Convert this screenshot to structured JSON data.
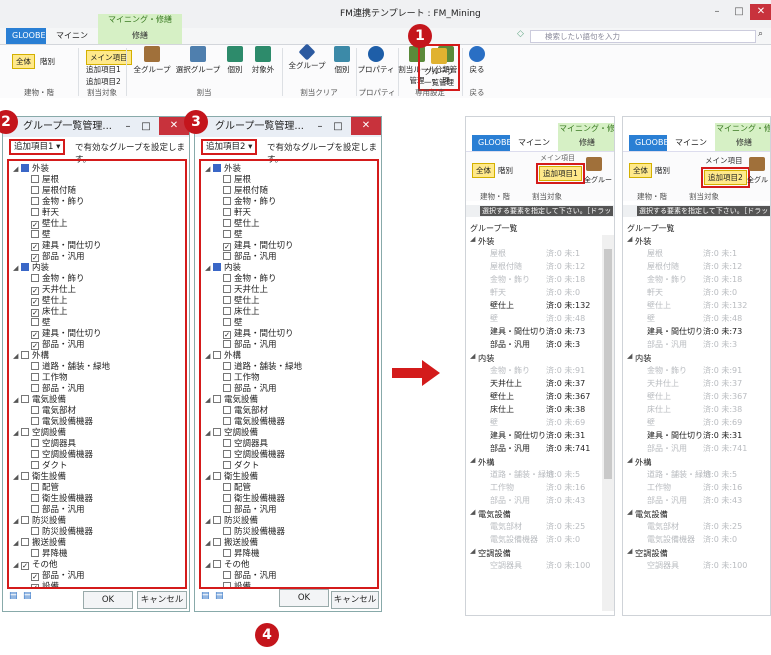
{
  "ribbon": {
    "context_group": "マイニング・修繕",
    "tabs": [
      "GLOOBE",
      "マイニング",
      "修繕"
    ],
    "title": "FM連携テンプレート : FM_Mining",
    "search_placeholder": "検索したい語句を入力",
    "buttons": {
      "all": "全体",
      "partial": "階別",
      "main_item": "メイン項目",
      "extra1": "追加項目1",
      "extra2": "追加項目2",
      "all_groups": "全グループ",
      "select_groups": "選択グループ",
      "individual": "個別",
      "excluded": "対象外",
      "clear_all_groups": "全グループ",
      "clear_individual": "個別",
      "property": "プロパティ",
      "assign_rule": "割当ルール\n管理",
      "category_mgmt": "分類管理",
      "group_list_mgmt": "グループ\n一覧管理",
      "back": "戻る"
    },
    "groups": [
      "建物・階",
      "割当対象",
      "割当",
      "割当クリア",
      "プロパティ",
      "専用設定",
      "戻る"
    ]
  },
  "markers": [
    "1",
    "2",
    "3",
    "4"
  ],
  "dialog1": {
    "title": "グループ一覧管理...",
    "selector": "追加項目1",
    "hint": "で有効なグループを設定します。",
    "tree": [
      {
        "label": "外装",
        "level": 0,
        "state": "part"
      },
      {
        "label": "屋根",
        "level": 1,
        "state": "off"
      },
      {
        "label": "屋根付随",
        "level": 1,
        "state": "off"
      },
      {
        "label": "金物・飾り",
        "level": 1,
        "state": "off"
      },
      {
        "label": "軒天",
        "level": 1,
        "state": "off"
      },
      {
        "label": "壁仕上",
        "level": 1,
        "state": "on"
      },
      {
        "label": "壁",
        "level": 1,
        "state": "off"
      },
      {
        "label": "建具・間仕切り",
        "level": 1,
        "state": "on"
      },
      {
        "label": "部品・汎用",
        "level": 1,
        "state": "on"
      },
      {
        "label": "内装",
        "level": 0,
        "state": "part"
      },
      {
        "label": "金物・飾り",
        "level": 1,
        "state": "off"
      },
      {
        "label": "天井仕上",
        "level": 1,
        "state": "on"
      },
      {
        "label": "壁仕上",
        "level": 1,
        "state": "on"
      },
      {
        "label": "床仕上",
        "level": 1,
        "state": "on"
      },
      {
        "label": "壁",
        "level": 1,
        "state": "off"
      },
      {
        "label": "建具・間仕切り",
        "level": 1,
        "state": "on"
      },
      {
        "label": "部品・汎用",
        "level": 1,
        "state": "on"
      },
      {
        "label": "外構",
        "level": 0,
        "state": "off"
      },
      {
        "label": "道路・舗装・緑地",
        "level": 1,
        "state": "off"
      },
      {
        "label": "工作物",
        "level": 1,
        "state": "off"
      },
      {
        "label": "部品・汎用",
        "level": 1,
        "state": "off"
      },
      {
        "label": "電気設備",
        "level": 0,
        "state": "off"
      },
      {
        "label": "電気部材",
        "level": 1,
        "state": "off"
      },
      {
        "label": "電気設備機器",
        "level": 1,
        "state": "off"
      },
      {
        "label": "空調設備",
        "level": 0,
        "state": "off"
      },
      {
        "label": "空調器具",
        "level": 1,
        "state": "off"
      },
      {
        "label": "空調設備機器",
        "level": 1,
        "state": "off"
      },
      {
        "label": "ダクト",
        "level": 1,
        "state": "off"
      },
      {
        "label": "衛生設備",
        "level": 0,
        "state": "off"
      },
      {
        "label": "配管",
        "level": 1,
        "state": "off"
      },
      {
        "label": "衛生設備機器",
        "level": 1,
        "state": "off"
      },
      {
        "label": "部品・汎用",
        "level": 1,
        "state": "off"
      },
      {
        "label": "防災設備",
        "level": 0,
        "state": "off"
      },
      {
        "label": "防災設備機器",
        "level": 1,
        "state": "off"
      },
      {
        "label": "搬送設備",
        "level": 0,
        "state": "off"
      },
      {
        "label": "昇降機",
        "level": 1,
        "state": "off"
      },
      {
        "label": "その他",
        "level": 0,
        "state": "on"
      },
      {
        "label": "部品・汎用",
        "level": 1,
        "state": "on"
      },
      {
        "label": "設備",
        "level": 1,
        "state": "on"
      }
    ],
    "ok": "OK",
    "cancel": "キャンセル"
  },
  "dialog2": {
    "title": "グループ一覧管理...",
    "selector": "追加項目2",
    "hint": "で有効なグループを設定します。",
    "tree": [
      {
        "label": "外装",
        "level": 0,
        "state": "part"
      },
      {
        "label": "屋根",
        "level": 1,
        "state": "off"
      },
      {
        "label": "屋根付随",
        "level": 1,
        "state": "off"
      },
      {
        "label": "金物・飾り",
        "level": 1,
        "state": "off"
      },
      {
        "label": "軒天",
        "level": 1,
        "state": "off"
      },
      {
        "label": "壁仕上",
        "level": 1,
        "state": "off"
      },
      {
        "label": "壁",
        "level": 1,
        "state": "off"
      },
      {
        "label": "建具・間仕切り",
        "level": 1,
        "state": "on"
      },
      {
        "label": "部品・汎用",
        "level": 1,
        "state": "off"
      },
      {
        "label": "内装",
        "level": 0,
        "state": "part"
      },
      {
        "label": "金物・飾り",
        "level": 1,
        "state": "off"
      },
      {
        "label": "天井仕上",
        "level": 1,
        "state": "off"
      },
      {
        "label": "壁仕上",
        "level": 1,
        "state": "off"
      },
      {
        "label": "床仕上",
        "level": 1,
        "state": "off"
      },
      {
        "label": "壁",
        "level": 1,
        "state": "off"
      },
      {
        "label": "建具・間仕切り",
        "level": 1,
        "state": "on"
      },
      {
        "label": "部品・汎用",
        "level": 1,
        "state": "off"
      },
      {
        "label": "外構",
        "level": 0,
        "state": "off"
      },
      {
        "label": "道路・舗装・緑地",
        "level": 1,
        "state": "off"
      },
      {
        "label": "工作物",
        "level": 1,
        "state": "off"
      },
      {
        "label": "部品・汎用",
        "level": 1,
        "state": "off"
      },
      {
        "label": "電気設備",
        "level": 0,
        "state": "off"
      },
      {
        "label": "電気部材",
        "level": 1,
        "state": "off"
      },
      {
        "label": "電気設備機器",
        "level": 1,
        "state": "off"
      },
      {
        "label": "空調設備",
        "level": 0,
        "state": "off"
      },
      {
        "label": "空調器具",
        "level": 1,
        "state": "off"
      },
      {
        "label": "空調設備機器",
        "level": 1,
        "state": "off"
      },
      {
        "label": "ダクト",
        "level": 1,
        "state": "off"
      },
      {
        "label": "衛生設備",
        "level": 0,
        "state": "off"
      },
      {
        "label": "配管",
        "level": 1,
        "state": "off"
      },
      {
        "label": "衛生設備機器",
        "level": 1,
        "state": "off"
      },
      {
        "label": "部品・汎用",
        "level": 1,
        "state": "off"
      },
      {
        "label": "防災設備",
        "level": 0,
        "state": "off"
      },
      {
        "label": "防災設備機器",
        "level": 1,
        "state": "off"
      },
      {
        "label": "搬送設備",
        "level": 0,
        "state": "off"
      },
      {
        "label": "昇降機",
        "level": 1,
        "state": "off"
      },
      {
        "label": "その他",
        "level": 0,
        "state": "off"
      },
      {
        "label": "部品・汎用",
        "level": 1,
        "state": "off"
      },
      {
        "label": "設備",
        "level": 1,
        "state": "off"
      }
    ],
    "ok": "OK",
    "cancel": "キャンセル"
  },
  "panel_a": {
    "ctx_group": "マイニング・修",
    "tabs": [
      "GLOOBE",
      "マイニング",
      "修繕"
    ],
    "all": "全体",
    "partial": "階別",
    "main_item": "メイン項目",
    "selected_item": "追加項目1",
    "all_groups": "全グルー",
    "group_labels": [
      "建物・階",
      "割当対象"
    ],
    "hint": "選択する要素を指定して下さい。［ドラッ",
    "list_title": "グループ一覧"
  },
  "panel_b": {
    "ctx_group": "マイニング・修",
    "tabs": [
      "GLOOBE",
      "マイニング",
      "修繕"
    ],
    "all": "全体",
    "partial": "階別",
    "main_item": "メイン項目",
    "selected_item": "追加項目2",
    "all_groups": "全グル",
    "group_labels": [
      "建物・階",
      "割当対象"
    ],
    "hint": "選択する要素を指定して下さい。［ドラッ",
    "list_title": "グループ一覧"
  },
  "list_a": [
    {
      "kind": "hdr",
      "nm": "外装"
    },
    {
      "kind": "dim",
      "nm": "屋根",
      "ct": "済:0 未:1"
    },
    {
      "kind": "dim",
      "nm": "屋根付随",
      "ct": "済:0 未:12"
    },
    {
      "kind": "dim",
      "nm": "金物・飾り",
      "ct": "済:0 未:18"
    },
    {
      "kind": "dim",
      "nm": "軒天",
      "ct": "済:0 未:0"
    },
    {
      "kind": "on",
      "nm": "壁仕上",
      "ct": "済:0 未:132"
    },
    {
      "kind": "dim",
      "nm": "壁",
      "ct": "済:0 未:48"
    },
    {
      "kind": "on",
      "nm": "建具・間仕切り",
      "ct": "済:0 未:73"
    },
    {
      "kind": "on",
      "nm": "部品・汎用",
      "ct": "済:0 未:3"
    },
    {
      "kind": "hdr",
      "nm": "内装"
    },
    {
      "kind": "dim",
      "nm": "金物・飾り",
      "ct": "済:0 未:91"
    },
    {
      "kind": "on",
      "nm": "天井仕上",
      "ct": "済:0 未:37"
    },
    {
      "kind": "on",
      "nm": "壁仕上",
      "ct": "済:0 未:367"
    },
    {
      "kind": "on",
      "nm": "床仕上",
      "ct": "済:0 未:38"
    },
    {
      "kind": "dim",
      "nm": "壁",
      "ct": "済:0 未:69"
    },
    {
      "kind": "on",
      "nm": "建具・間仕切り",
      "ct": "済:0 未:31"
    },
    {
      "kind": "on",
      "nm": "部品・汎用",
      "ct": "済:0 未:741"
    },
    {
      "kind": "hdr",
      "nm": "外構"
    },
    {
      "kind": "dim",
      "nm": "道路・舗装・緑地",
      "ct": "済:0 未:5"
    },
    {
      "kind": "dim",
      "nm": "工作物",
      "ct": "済:0 未:16"
    },
    {
      "kind": "dim",
      "nm": "部品・汎用",
      "ct": "済:0 未:43"
    },
    {
      "kind": "hdr",
      "nm": "電気設備"
    },
    {
      "kind": "dim",
      "nm": "電気部材",
      "ct": "済:0 未:25"
    },
    {
      "kind": "dim",
      "nm": "電気設備機器",
      "ct": "済:0 未:0"
    },
    {
      "kind": "hdr",
      "nm": "空調設備"
    },
    {
      "kind": "dim",
      "nm": "空調器具",
      "ct": "済:0 未:100"
    }
  ],
  "list_b": [
    {
      "kind": "hdr",
      "nm": "外装"
    },
    {
      "kind": "dim",
      "nm": "屋根",
      "ct": "済:0 未:1"
    },
    {
      "kind": "dim",
      "nm": "屋根付随",
      "ct": "済:0 未:12"
    },
    {
      "kind": "dim",
      "nm": "金物・飾り",
      "ct": "済:0 未:18"
    },
    {
      "kind": "dim",
      "nm": "軒天",
      "ct": "済:0 未:0"
    },
    {
      "kind": "dim",
      "nm": "壁仕上",
      "ct": "済:0 未:132"
    },
    {
      "kind": "dim",
      "nm": "壁",
      "ct": "済:0 未:48"
    },
    {
      "kind": "on",
      "nm": "建具・間仕切り",
      "ct": "済:0 未:73"
    },
    {
      "kind": "dim",
      "nm": "部品・汎用",
      "ct": "済:0 未:3"
    },
    {
      "kind": "hdr",
      "nm": "内装"
    },
    {
      "kind": "dim",
      "nm": "金物・飾り",
      "ct": "済:0 未:91"
    },
    {
      "kind": "dim",
      "nm": "天井仕上",
      "ct": "済:0 未:37"
    },
    {
      "kind": "dim",
      "nm": "壁仕上",
      "ct": "済:0 未:367"
    },
    {
      "kind": "dim",
      "nm": "床仕上",
      "ct": "済:0 未:38"
    },
    {
      "kind": "dim",
      "nm": "壁",
      "ct": "済:0 未:69"
    },
    {
      "kind": "on",
      "nm": "建具・間仕切り",
      "ct": "済:0 未:31"
    },
    {
      "kind": "dim",
      "nm": "部品・汎用",
      "ct": "済:0 未:741"
    },
    {
      "kind": "hdr",
      "nm": "外構"
    },
    {
      "kind": "dim",
      "nm": "道路・舗装・緑地",
      "ct": "済:0 未:5"
    },
    {
      "kind": "dim",
      "nm": "工作物",
      "ct": "済:0 未:16"
    },
    {
      "kind": "dim",
      "nm": "部品・汎用",
      "ct": "済:0 未:43"
    },
    {
      "kind": "hdr",
      "nm": "電気設備"
    },
    {
      "kind": "dim",
      "nm": "電気部材",
      "ct": "済:0 未:25"
    },
    {
      "kind": "dim",
      "nm": "電気設備機器",
      "ct": "済:0 未:0"
    },
    {
      "kind": "hdr",
      "nm": "空調設備"
    },
    {
      "kind": "dim",
      "nm": "空調器具",
      "ct": "済:0 未:100"
    }
  ],
  "colors": {
    "accent": "#c4151c",
    "globe_tab": "#2a7fd4",
    "ctx_green": "#d6f0c5",
    "highlight": "#ffe98a",
    "arrow": "#d31b1b"
  }
}
